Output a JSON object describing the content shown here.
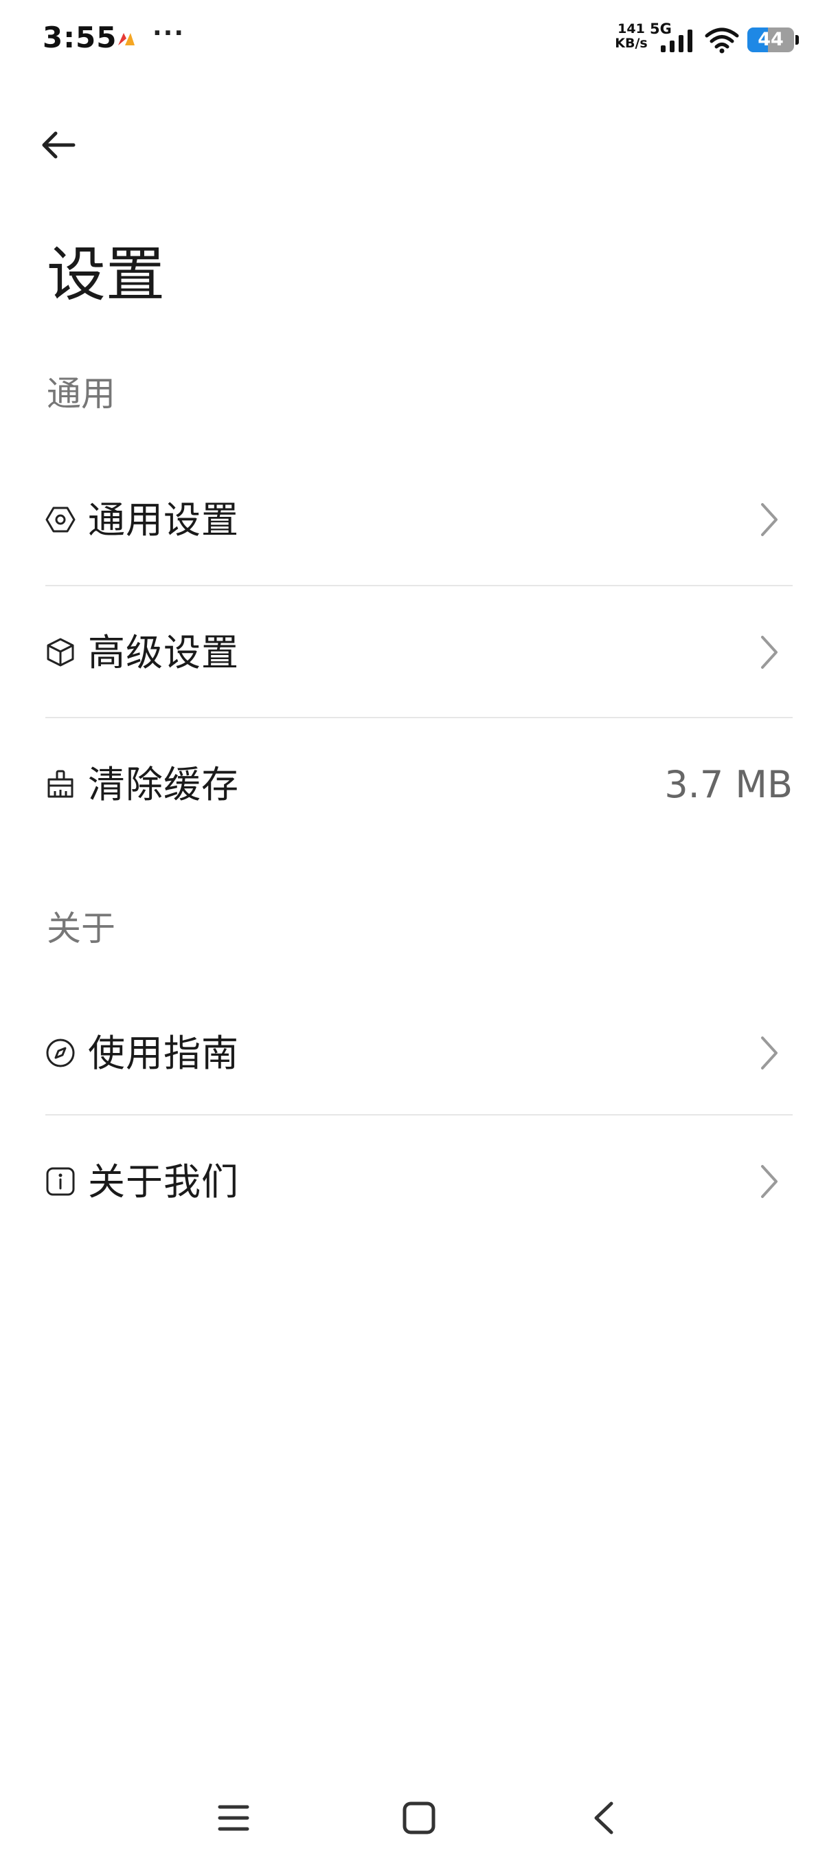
{
  "status_bar": {
    "time": "3:55",
    "more": "···",
    "speed_value": "141",
    "speed_unit": "KB/s",
    "network_type": "5G",
    "battery": "44",
    "battery_level": 0.44,
    "app_icon": "app-notification-icon",
    "colors": {
      "battery_fill": "#1e88e5",
      "app_icon_orange": "#f5a623",
      "app_icon_red": "#e53935"
    }
  },
  "header": {
    "back_icon": "arrow-left-icon",
    "title": "设置"
  },
  "sections": {
    "general": {
      "header": "通用",
      "items": [
        {
          "label": "通用设置",
          "icon": "hexagon-settings-icon",
          "chevron": "chevron-right-icon"
        },
        {
          "label": "高级设置",
          "icon": "cube-icon",
          "chevron": "chevron-right-icon"
        },
        {
          "label": "清除缓存",
          "icon": "broom-icon",
          "value": "3.7 MB"
        }
      ]
    },
    "about": {
      "header": "关于",
      "items": [
        {
          "label": "使用指南",
          "icon": "compass-icon",
          "chevron": "chevron-right-icon"
        },
        {
          "label": "关于我们",
          "icon": "info-icon",
          "chevron": "chevron-right-icon"
        }
      ]
    }
  },
  "nav_bar": {
    "menu_icon": "menu-icon",
    "home_icon": "home-square-icon",
    "back_icon": "nav-back-icon"
  }
}
